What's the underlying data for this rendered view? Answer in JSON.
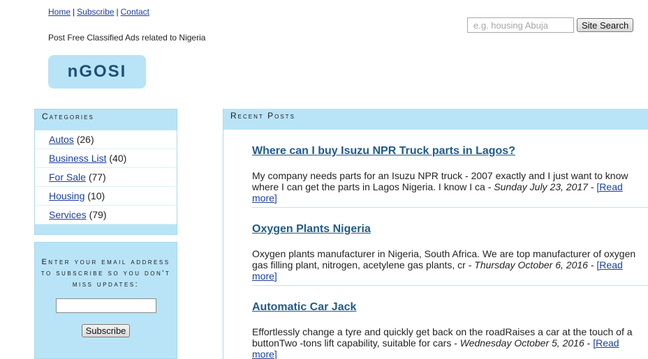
{
  "nav": {
    "home": "Home",
    "subscribe": "Subscribe",
    "contact": "Contact",
    "separator": "|"
  },
  "tagline": "Post Free Classified Ads related to Nigeria",
  "logo": {
    "text": "nGOSI"
  },
  "search": {
    "placeholder": "e.g. housing Abuja",
    "button_label": "Site Search"
  },
  "categories": {
    "heading": "Categories",
    "items": [
      {
        "label": "Autos",
        "count": "(26)"
      },
      {
        "label": "Business List",
        "count": "(40)"
      },
      {
        "label": "For Sale",
        "count": "(77)"
      },
      {
        "label": "Housing",
        "count": "(10)"
      },
      {
        "label": "Services",
        "count": "(79)"
      }
    ]
  },
  "subscribe": {
    "message": "Enter your email address to subscribe so you don't miss updates:",
    "button_label": "Subscribe"
  },
  "recent": {
    "heading": "Recent Posts",
    "read_more": "[Read more]",
    "posts": [
      {
        "title": "Where can I buy Isuzu NPR Truck parts in Lagos?",
        "excerpt": "My company needs parts for an Isuzu NPR truck - 2007 exactly and I just want to know where I can get the parts in Lagos Nigeria. I know I ca - ",
        "date": "Sunday July 23, 2017",
        "date_suffix": " - "
      },
      {
        "title": "Oxygen Plants Nigeria",
        "excerpt": "Oxygen plants manufacturer in Nigeria, South Africa. We are top manufacturer of oxygen gas filling plant, nitrogen, acetylene gas plants, cr - ",
        "date": "Thursday October 6, 2016",
        "date_suffix": " - "
      },
      {
        "title": "Automatic Car Jack",
        "excerpt": "Effortlessly change a tyre and quickly get back on the roadRaises a car at the touch of a buttonTwo -tons lift capability, suitable for cars - ",
        "date": "Wednesday October 5, 2016",
        "date_suffix": " - "
      }
    ]
  },
  "colors": {
    "accent_blue": "#b9e4f7",
    "link": "#1a3f9e",
    "post_title": "#1f5a8a"
  }
}
